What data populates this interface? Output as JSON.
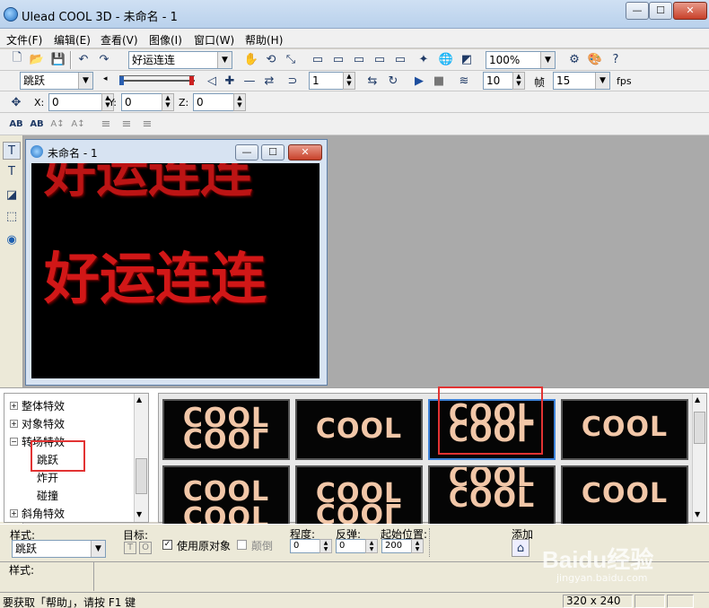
{
  "window": {
    "title": "Ulead COOL 3D - 未命名 - 1",
    "min_label": "—",
    "max_label": "☐",
    "close_label": "✕"
  },
  "menu": [
    "文件(F)",
    "编辑(E)",
    "查看(V)",
    "图像(I)",
    "窗口(W)",
    "帮助(H)"
  ],
  "toolbar1": {
    "text_select": "好运连连",
    "zoom": "100%"
  },
  "toolbar2": {
    "effect_select": "跳跃",
    "frame_value": "1",
    "frame_count": "10",
    "frame_label": "帧",
    "fps_value": "15",
    "fps_label": "fps"
  },
  "toolbar3": {
    "x_label": "X:",
    "x_value": "0",
    "y_label": "Y:",
    "y_value": "0",
    "z_label": "Z:",
    "z_value": "0"
  },
  "document": {
    "title": "未命名 - 1",
    "text_line": "好运连连"
  },
  "tree": {
    "items": [
      "整体特效",
      "对象特效",
      "转场特效",
      "跳跃",
      "炸开",
      "碰撞",
      "斜角特效"
    ]
  },
  "thumbnails": {
    "label": "COOL"
  },
  "options": {
    "style_label": "样式:",
    "style_value": "跳跃",
    "target_label": "目标:",
    "target_t": "T",
    "target_o": "O",
    "use_original": "使用原对象",
    "invert": "颠倒",
    "degree_label": "程度:",
    "degree_value": "0",
    "bounce_label": "反弹:",
    "bounce_value": "0",
    "start_label": "起始位置:",
    "start_value": "200",
    "add_label": "添加"
  },
  "style_panel": {
    "label": "样式:"
  },
  "status": {
    "help_text": "要获取「帮助」，请按 F1 键",
    "size": "320 x 240"
  },
  "watermark": {
    "brand": "Baidu经验",
    "url": "jingyan.baidu.com"
  },
  "colors": {
    "highlight": "#e23333",
    "text_red": "#d11717",
    "cool_text": "#f2c7a8"
  }
}
